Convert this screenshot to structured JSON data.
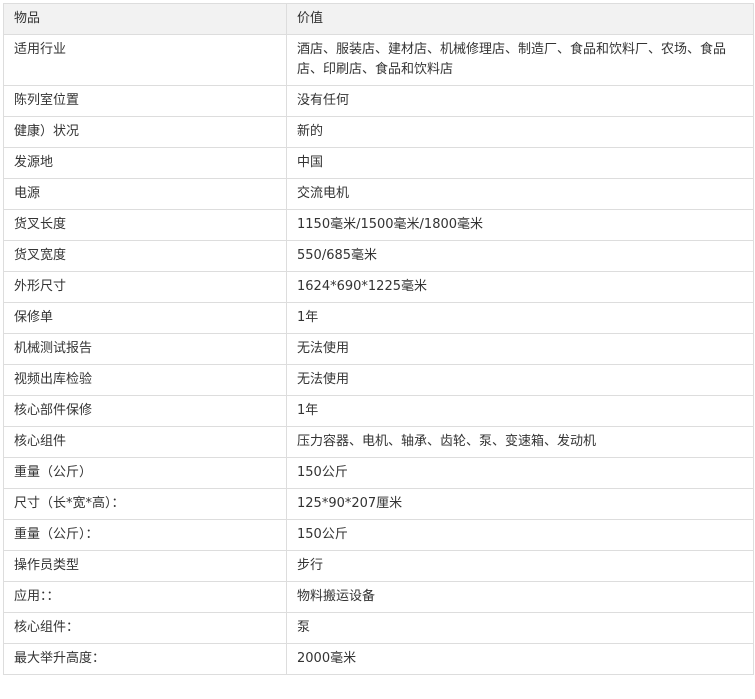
{
  "table": {
    "headers": [
      "物品",
      "价值"
    ],
    "rows": [
      [
        "适用行业",
        "酒店、服装店、建材店、机械修理店、制造厂、食品和饮料厂、农场、食品店、印刷店、食品和饮料店"
      ],
      [
        "陈列室位置",
        "没有任何"
      ],
      [
        "健康）状况",
        "新的"
      ],
      [
        "发源地",
        "中国"
      ],
      [
        "电源",
        "交流电机"
      ],
      [
        "货叉长度",
        "1150毫米/1500毫米/1800毫米"
      ],
      [
        "货叉宽度",
        "550/685毫米"
      ],
      [
        "外形尺寸",
        "1624*690*1225毫米"
      ],
      [
        "保修单",
        "1年"
      ],
      [
        "机械测试报告",
        "无法使用"
      ],
      [
        "视频出库检验",
        "无法使用"
      ],
      [
        "核心部件保修",
        "1年"
      ],
      [
        "核心组件",
        "压力容器、电机、轴承、齿轮、泵、变速箱、发动机"
      ],
      [
        "重量（公斤）",
        "150公斤"
      ],
      [
        "尺寸（长*宽*高）：",
        "125*90*207厘米"
      ],
      [
        "重量（公斤）：",
        "150公斤"
      ],
      [
        "操作员类型",
        "步行"
      ],
      [
        "应用：：",
        "物料搬运设备"
      ],
      [
        "核心组件：",
        "泵"
      ],
      [
        "最大举升高度：",
        "2000毫米"
      ]
    ]
  }
}
